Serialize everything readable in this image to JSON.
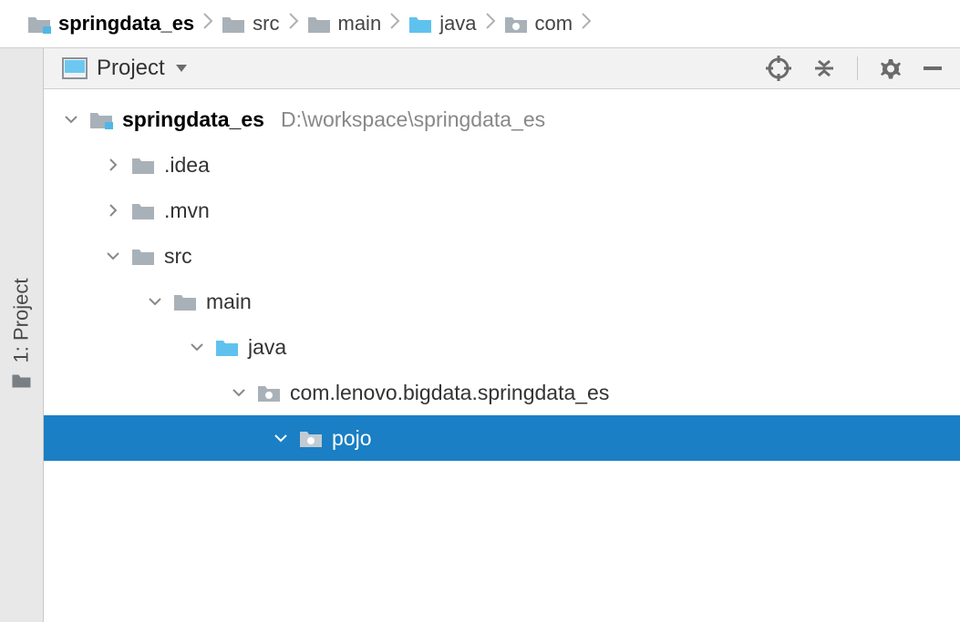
{
  "breadcrumb": {
    "items": [
      {
        "label": "springdata_es",
        "bold": true,
        "icon": "module"
      },
      {
        "label": "src",
        "icon": "folder-gray"
      },
      {
        "label": "main",
        "icon": "folder-gray"
      },
      {
        "label": "java",
        "icon": "folder-blue"
      },
      {
        "label": "com",
        "icon": "package"
      }
    ]
  },
  "sidebar": {
    "tab_label": "1: Project"
  },
  "tool_header": {
    "title": "Project"
  },
  "tree": {
    "root": {
      "label": "springdata_es",
      "path_hint": "D:\\workspace\\springdata_es"
    },
    "idea": {
      "label": ".idea"
    },
    "mvn": {
      "label": ".mvn"
    },
    "src": {
      "label": "src"
    },
    "main": {
      "label": "main"
    },
    "java": {
      "label": "java"
    },
    "package": {
      "label": "com.lenovo.bigdata.springdata_es"
    },
    "pojo": {
      "label": "pojo"
    }
  }
}
